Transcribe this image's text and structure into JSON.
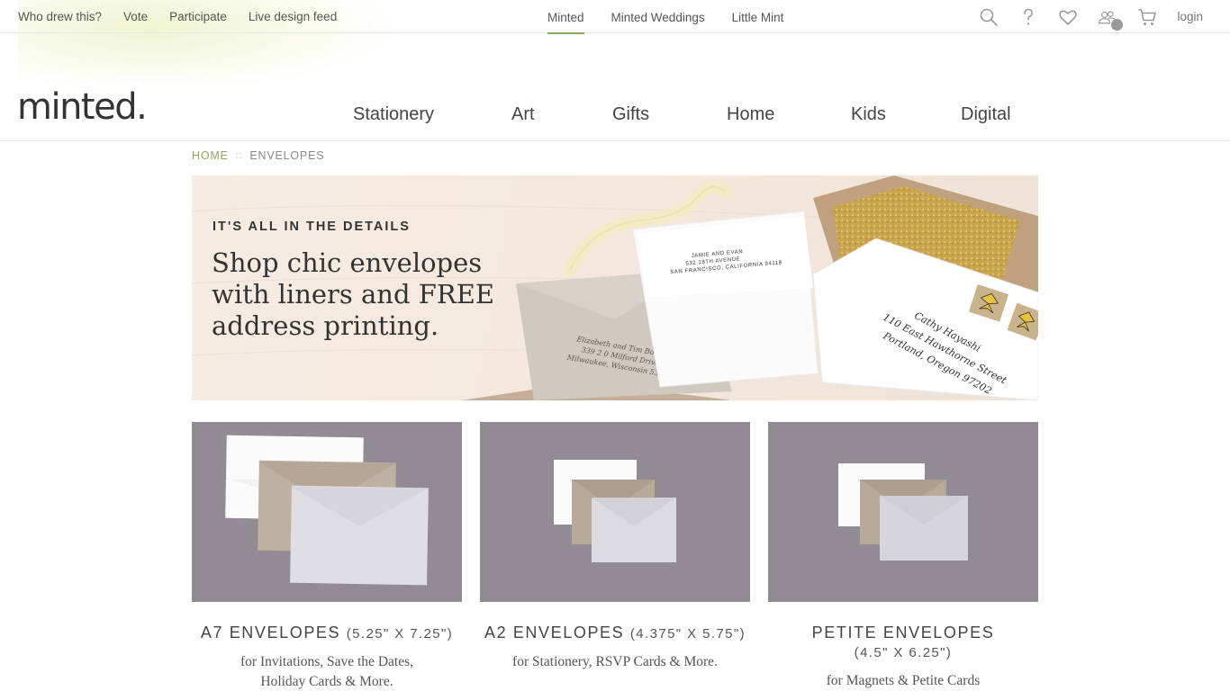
{
  "utility_nav": {
    "left_links": [
      "Who drew this?",
      "Vote",
      "Participate",
      "Live design feed"
    ],
    "brand_tabs": [
      "Minted",
      "Minted Weddings",
      "Little Mint"
    ],
    "active_tab": "Minted",
    "login_label": "login",
    "icons": [
      "search-icon",
      "help-icon",
      "heart-icon",
      "community-icon",
      "cart-icon"
    ]
  },
  "header": {
    "logo_text": "minted.",
    "nav": [
      "Stationery",
      "Art",
      "Gifts",
      "Home",
      "Kids",
      "Digital"
    ]
  },
  "breadcrumb": {
    "home": "HOME",
    "separator": "::",
    "current": "ENVELOPES"
  },
  "hero": {
    "eyebrow": "IT'S ALL IN THE DETAILS",
    "headline": "Shop chic envelopes with liners and FREE address printing.",
    "address_1": [
      "Elizabeth and Tim Bowen",
      "339 2 0 Milford Drive",
      "Milwaukee, Wisconsin 53013"
    ],
    "address_2": [
      "JAMIE AND EVAN",
      "532 18TH AVENUE",
      "SAN FRANCISCO, CALIFORNIA 94118"
    ],
    "address_3": [
      "Cathy Hayashi",
      "110 East Hawthorne Street",
      "Portland, Oregon 97202"
    ]
  },
  "products": [
    {
      "name": "A7 ENVELOPES",
      "size": "(5.25\" X 7.25\")",
      "desc_1": "for Invitations, Save the Dates,",
      "desc_2": "Holiday Cards & More."
    },
    {
      "name": "A2 ENVELOPES",
      "size": "(4.375\" X 5.75\")",
      "desc_1": "for Stationery, RSVP Cards & More.",
      "desc_2": ""
    },
    {
      "name": "PETITE ENVELOPES",
      "size": "(4.5\" X 6.25\")",
      "desc_1": "for Magnets & Petite Cards",
      "desc_2": ""
    }
  ],
  "colors": {
    "accent_green": "#8dab5d",
    "thumb_bg": "#918c93",
    "hero_bg": "#f5e9df"
  }
}
